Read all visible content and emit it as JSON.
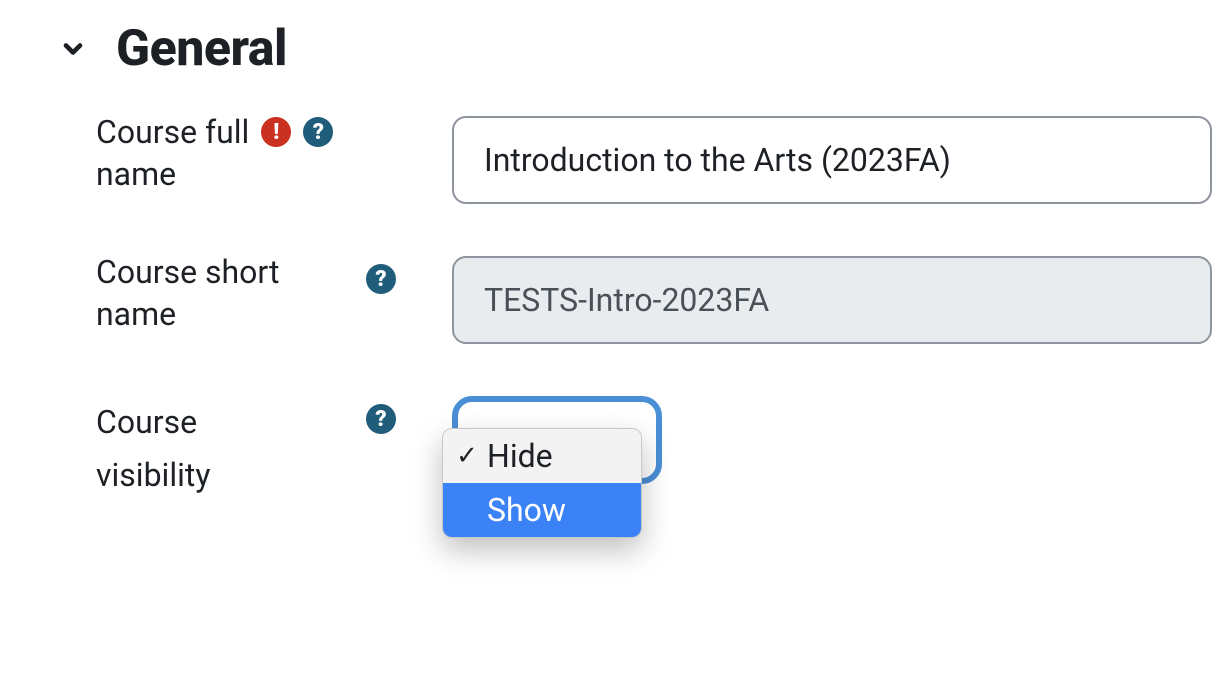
{
  "section": {
    "title": "General"
  },
  "fields": {
    "fullname": {
      "label_line1": "Course full",
      "label_line2": "name",
      "value": "Introduction to the Arts (2023FA)"
    },
    "shortname": {
      "label_line1": "Course short",
      "label_line2": "name",
      "value": "TESTS-Intro-2023FA"
    },
    "visibility": {
      "label_line1": "Course",
      "label_line2": "visibility",
      "options": {
        "hide": "Hide",
        "show": "Show"
      },
      "checkmark": "✓"
    }
  }
}
